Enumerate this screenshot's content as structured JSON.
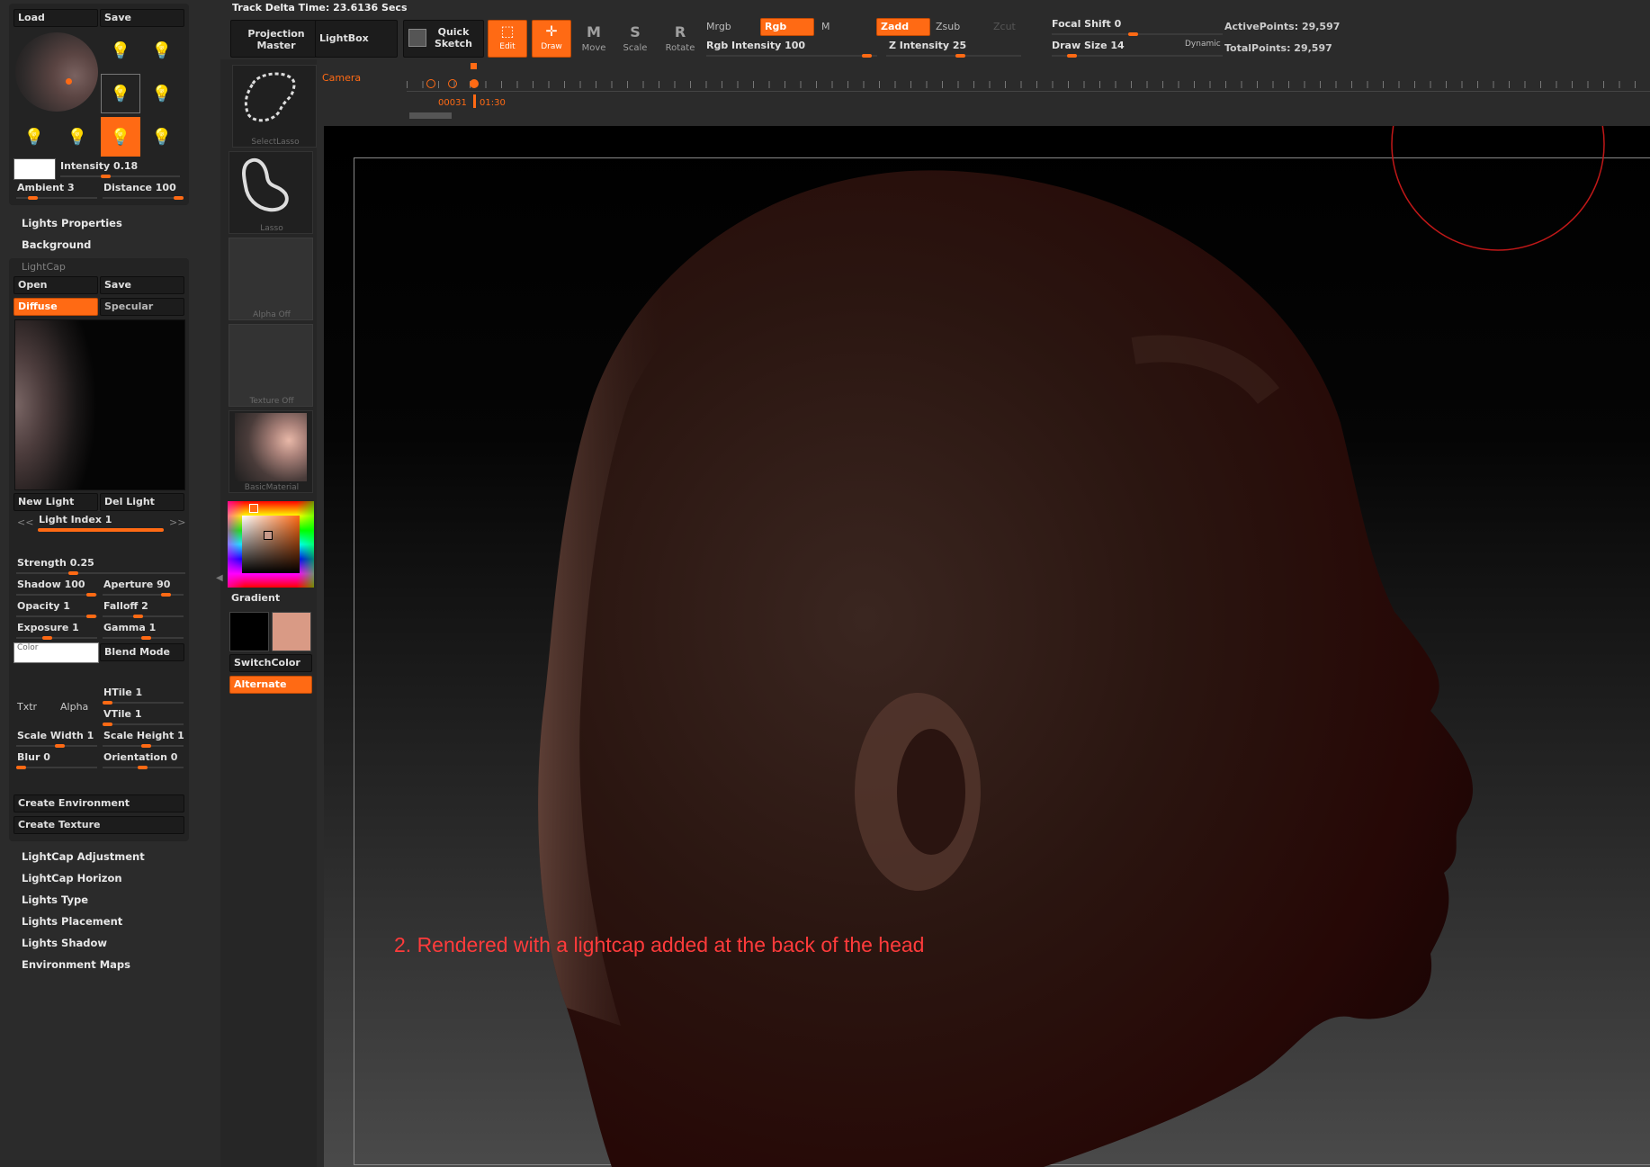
{
  "header": {
    "track_time": "Track Delta Time: 23.6136 Secs"
  },
  "light_panel": {
    "load": "Load",
    "save": "Save",
    "intensity": "Intensity 0.18",
    "ambient": "Ambient 3",
    "distance": "Distance 100"
  },
  "menus_top": [
    "Lights Properties",
    "Background"
  ],
  "lightcap": {
    "title": "LightCap",
    "open": "Open",
    "save": "Save",
    "diffuse": "Diffuse",
    "specular": "Specular",
    "new_light": "New Light",
    "del_light": "Del Light",
    "prev": "<<",
    "next": ">>",
    "light_index": "Light Index 1",
    "strength": "Strength 0.25",
    "shadow": "Shadow 100",
    "aperture": "Aperture 90",
    "opacity": "Opacity 1",
    "falloff": "Falloff 2",
    "exposure": "Exposure 1",
    "gamma": "Gamma 1",
    "color": "Color",
    "blend_mode": "Blend Mode",
    "txtr": "Txtr",
    "alpha": "Alpha",
    "htile": "HTile 1",
    "vtile": "VTile 1",
    "scale_width": "Scale Width 1",
    "scale_height": "Scale Height 1",
    "blur": "Blur 0",
    "orientation": "Orientation 0",
    "create_env": "Create Environment",
    "create_tex": "Create Texture"
  },
  "menus_bottom": [
    "LightCap Adjustment",
    "LightCap Horizon",
    "Lights Type",
    "Lights Placement",
    "Lights Shadow",
    "Environment Maps"
  ],
  "toolbar": {
    "projection_master": "Projection Master",
    "lightbox": "LightBox",
    "quick_sketch": "Quick Sketch",
    "edit": "Edit",
    "draw": "Draw",
    "move": "Move",
    "scale": "Scale",
    "rotate": "Rotate",
    "mrgb": "Mrgb",
    "rgb": "Rgb",
    "m": "M",
    "zadd": "Zadd",
    "zsub": "Zsub",
    "zcut": "Zcut",
    "rgb_intensity": "Rgb Intensity 100",
    "z_intensity": "Z Intensity 25",
    "focal_shift": "Focal Shift 0",
    "draw_size": "Draw Size 14",
    "dynamic": "Dynamic",
    "active_points": "ActivePoints: 29,597",
    "total_points": "TotalPoints: 29,597"
  },
  "timeline": {
    "camera": "Camera",
    "frame": "00031",
    "time": "01:30"
  },
  "left_shelf": {
    "select_lasso": "SelectLasso",
    "lasso": "Lasso",
    "alpha_off": "Alpha Off",
    "texture_off": "Texture Off",
    "basic_material": "BasicMaterial",
    "gradient": "Gradient",
    "switch_color": "SwitchColor",
    "alternate": "Alternate"
  },
  "canvas": {
    "caption": "2. Rendered with a lightcap added at the back of the head"
  },
  "colors": {
    "accent": "#ff6a14",
    "secondary_color": "#d99a85",
    "caption": "#ff3b3b"
  }
}
